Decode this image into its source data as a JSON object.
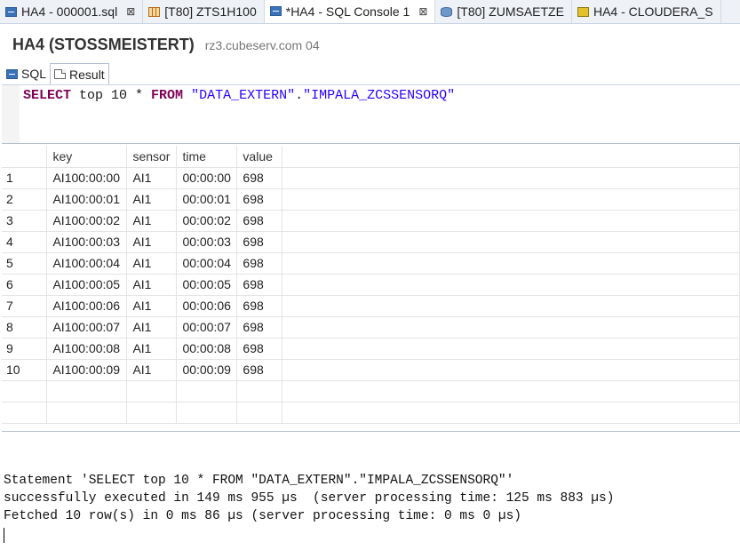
{
  "tabs": [
    {
      "label": "HA4 - 000001.sql",
      "icon": "sql-file-icon",
      "close": "⊠",
      "active": false
    },
    {
      "label": "[T80] ZTS1H100",
      "icon": "table-icon",
      "close": "",
      "active": false
    },
    {
      "label": "*HA4 - SQL Console 1",
      "icon": "sql-file-icon",
      "close": "⊠",
      "active": true
    },
    {
      "label": "[T80] ZUMSAETZE",
      "icon": "database-icon",
      "close": "",
      "active": false
    },
    {
      "label": "HA4 - CLOUDERA_S",
      "icon": "cube-icon",
      "close": "",
      "active": false
    }
  ],
  "header": {
    "title": "HA4 (STOSSMEISTERT)",
    "host": "rz3.cubeserv.com 04"
  },
  "subtabs": {
    "sql": "SQL",
    "result": "Result"
  },
  "editor": {
    "kw_select": "SELECT",
    "plain1": " top 10 * ",
    "kw_from": "FROM",
    "plain2": " ",
    "str_schema": "\"DATA_EXTERN\"",
    "dot": ".",
    "str_table": "\"IMPALA_ZCSSENSORQ\""
  },
  "grid": {
    "columns": [
      "key",
      "sensor",
      "time",
      "value"
    ],
    "rows": [
      [
        "1",
        "AI100:00:00",
        "AI1",
        "00:00:00",
        "698"
      ],
      [
        "2",
        "AI100:00:01",
        "AI1",
        "00:00:01",
        "698"
      ],
      [
        "3",
        "AI100:00:02",
        "AI1",
        "00:00:02",
        "698"
      ],
      [
        "4",
        "AI100:00:03",
        "AI1",
        "00:00:03",
        "698"
      ],
      [
        "5",
        "AI100:00:04",
        "AI1",
        "00:00:04",
        "698"
      ],
      [
        "6",
        "AI100:00:05",
        "AI1",
        "00:00:05",
        "698"
      ],
      [
        "7",
        "AI100:00:06",
        "AI1",
        "00:00:06",
        "698"
      ],
      [
        "8",
        "AI100:00:07",
        "AI1",
        "00:00:07",
        "698"
      ],
      [
        "9",
        "AI100:00:08",
        "AI1",
        "00:00:08",
        "698"
      ],
      [
        "10",
        "AI100:00:09",
        "AI1",
        "00:00:09",
        "698"
      ]
    ]
  },
  "console": {
    "line1": "Statement 'SELECT top 10 * FROM \"DATA_EXTERN\".\"IMPALA_ZCSSENSORQ\"'",
    "line2": "successfully executed in 149 ms 955 µs  (server processing time: 125 ms 883 µs)",
    "line3": "Fetched 10 row(s) in 0 ms 86 µs (server processing time: 0 ms 0 µs)"
  },
  "colors": {
    "keyword": "#7f0055",
    "string": "#2a00ff"
  }
}
